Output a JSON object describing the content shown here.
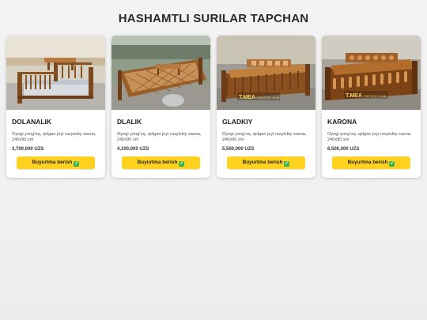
{
  "page": {
    "title": "HASHAMTLI SURILAR TAPCHAN"
  },
  "products": [
    {
      "name": "DOLANALIK",
      "description": "Oyogi yong'oq, qolgan joyi rasyiskiy sasna, 240x90 sm",
      "price": "3,700,000 UZS",
      "button": "Buyurtma berish",
      "image": "daybed-photo-plain-rails-mattress"
    },
    {
      "name": "DLALIK",
      "description": "Oyogi yong'oq, qolgan joyi rasyiskiy sasna, 240x90 sm",
      "price": "4,100,000 UZS",
      "button": "Buyurtma berish",
      "image": "daybed-photo-lattice-base-outdoor"
    },
    {
      "name": "GLADKIY",
      "description": "Oyogi yong'oq, qolgan joyi rasyiskiy sasna, 240x90 sm",
      "price": "5,500,000 UZS",
      "button": "Buyurtma berish",
      "image": "daybed-photo-carved-table-watermark"
    },
    {
      "name": "KARONA",
      "description": "Oyogi yong'oq, qolgan joyi rasyiskiy sasna, 240x90 sm",
      "price": "6,500,000 UZS",
      "button": "Buyurtma berish",
      "image": "daybed-photo-ornate-carved-watermark"
    }
  ],
  "watermark": {
    "text": "T.MEA",
    "sub": "+998 99 871 00 88"
  },
  "colors": {
    "button": "#ffd21f",
    "check": "#3bb54a",
    "wood": "#a8642a",
    "wood_dark": "#6e3d17"
  }
}
